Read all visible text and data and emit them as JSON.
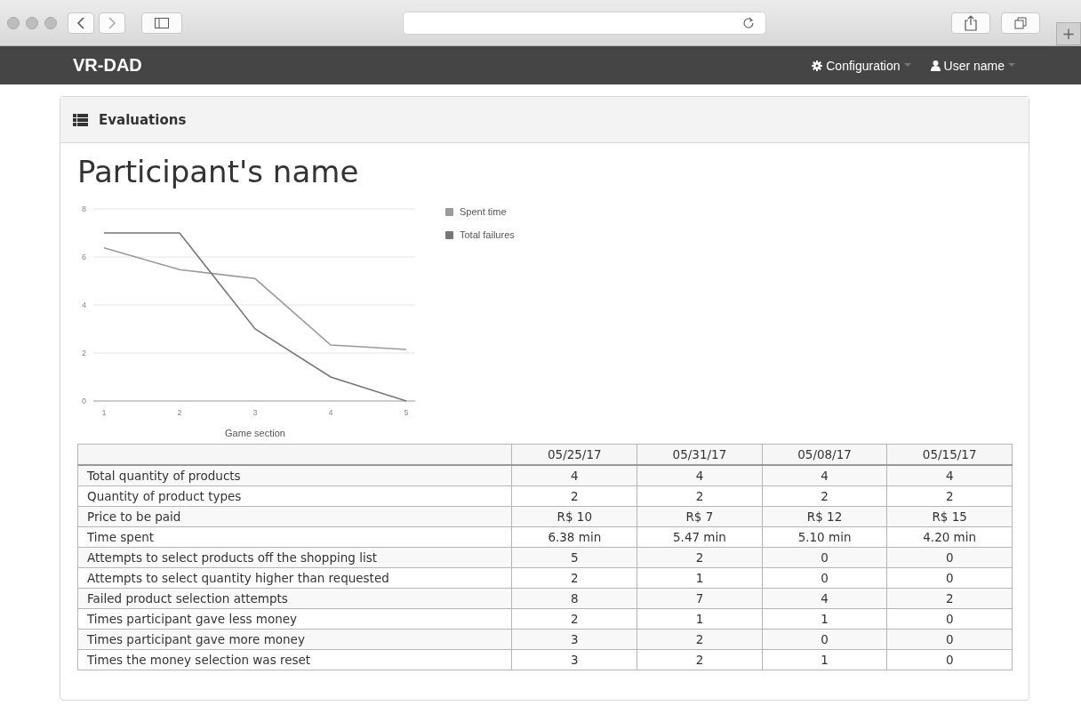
{
  "browser": {
    "new_tab": "+"
  },
  "navbar": {
    "brand": "VR-DAD",
    "menus": [
      {
        "label": "Configuration",
        "kind": "gear"
      },
      {
        "label": "User name",
        "kind": "user"
      }
    ]
  },
  "panel": {
    "title": "Evaluations"
  },
  "heading": "Participant's name",
  "chart": {
    "chart_data": {
      "type": "line",
      "grid": true,
      "legend": "right",
      "xlabel": "Game section",
      "categories": [
        "1",
        "2",
        "3",
        "4",
        "5"
      ],
      "yticks": [
        0,
        2,
        4,
        6,
        8
      ],
      "ylim": [
        0,
        8
      ],
      "series": [
        {
          "name": "Spent time",
          "color": "#9a9a9a",
          "values": [
            6.38,
            5.47,
            5.1,
            2.33,
            2.15
          ]
        },
        {
          "name": "Total failures",
          "color": "#777777",
          "values": [
            7,
            7,
            3,
            1,
            0
          ]
        }
      ]
    }
  },
  "table": {
    "columns": [
      "05/25/17",
      "05/31/17",
      "05/08/17",
      "05/15/17"
    ],
    "rows": [
      {
        "label": "Total quantity of products",
        "cells": [
          "4",
          "4",
          "4",
          "4"
        ]
      },
      {
        "label": "Quantity of product types",
        "cells": [
          "2",
          "2",
          "2",
          "2"
        ]
      },
      {
        "label": "Price to be paid",
        "cells": [
          "R$ 10",
          "R$ 7",
          "R$ 12",
          "R$ 15"
        ]
      },
      {
        "label": "Time spent",
        "cells": [
          "6.38 min",
          "5.47 min",
          "5.10 min",
          "4.20 min"
        ]
      },
      {
        "label": "Attempts to select products off the shopping list",
        "cells": [
          "5",
          "2",
          "0",
          "0"
        ]
      },
      {
        "label": "Attempts to select quantity higher than requested",
        "cells": [
          "2",
          "1",
          "0",
          "0"
        ]
      },
      {
        "label": "Failed product selection attempts",
        "cells": [
          "8",
          "7",
          "4",
          "2"
        ]
      },
      {
        "label": "Times participant gave less money",
        "cells": [
          "2",
          "1",
          "1",
          "0"
        ]
      },
      {
        "label": "Times participant gave more money",
        "cells": [
          "3",
          "2",
          "0",
          "0"
        ]
      },
      {
        "label": "Times the money selection was reset",
        "cells": [
          "3",
          "2",
          "1",
          "0"
        ]
      }
    ]
  }
}
